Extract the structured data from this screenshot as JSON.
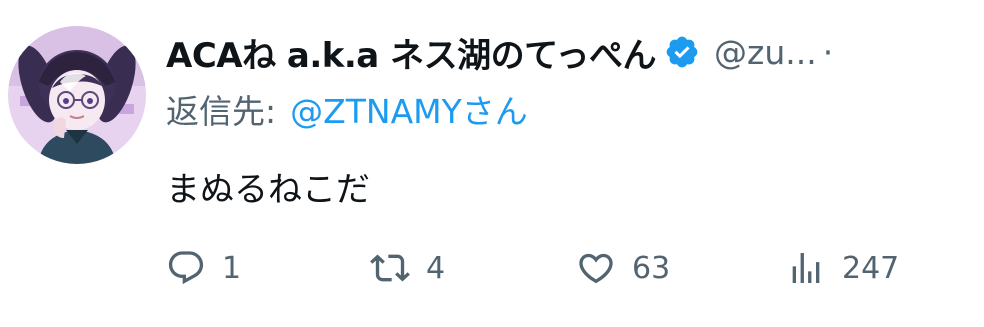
{
  "author": {
    "display_name": "ACAね a.k.a ネス湖のてっぺん",
    "handle": "@zu...",
    "separator": "·",
    "verified": true,
    "verified_color": "#1d9bf0"
  },
  "reply": {
    "prefix": "返信先:",
    "user": "@ZTNAMYさん"
  },
  "tweet": {
    "text": "まぬるねこだ"
  },
  "actions": {
    "replies": "1",
    "retweets": "4",
    "likes": "63",
    "views": "247"
  },
  "icons": {
    "reply": "reply-icon",
    "retweet": "retweet-icon",
    "like": "heart-icon",
    "views": "views-icon",
    "verified": "verified-badge-icon"
  },
  "colors": {
    "accent": "#1d9bf0",
    "secondary_text": "#536471",
    "primary_text": "#0f1419"
  }
}
